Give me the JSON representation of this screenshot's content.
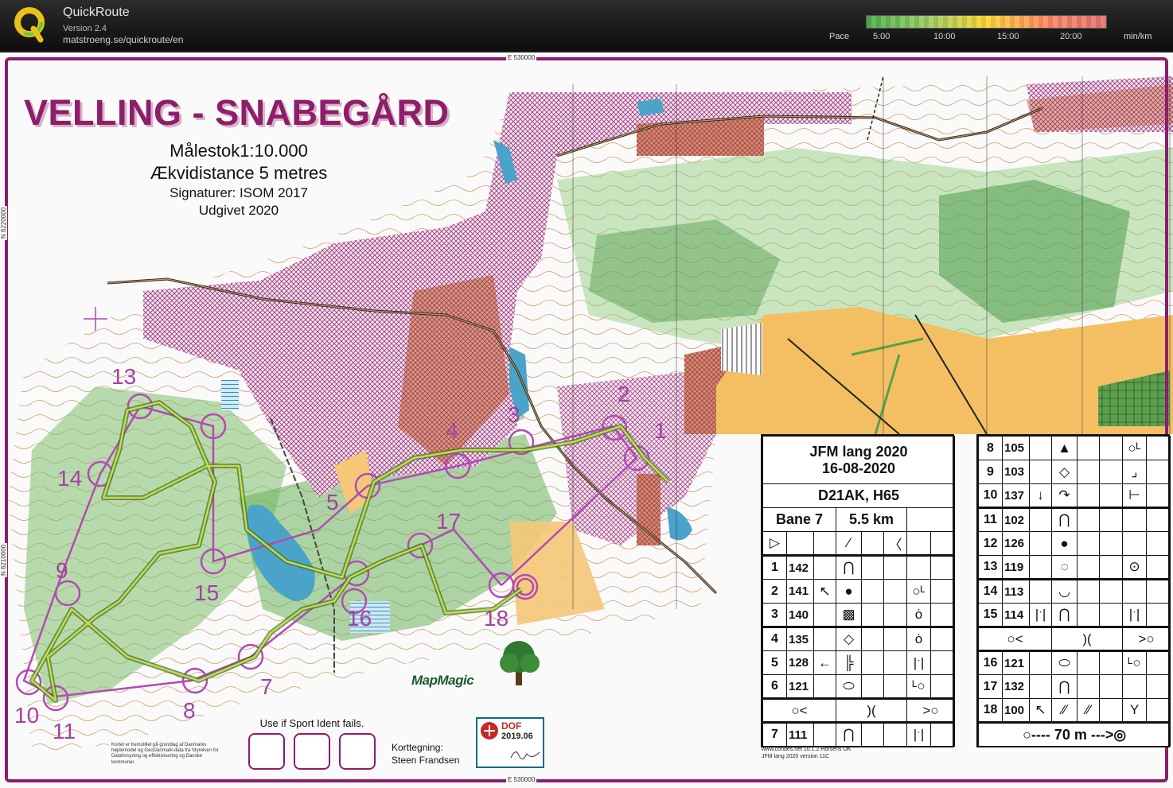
{
  "app": {
    "title": "QuickRoute",
    "version": "Version 2.4",
    "url": "matstroeng.se/quickroute/en"
  },
  "pace_scale": {
    "label": "Pace",
    "ticks": [
      "5:00",
      "10:00",
      "15:00",
      "20:00"
    ],
    "unit": "min/km",
    "colors": [
      "#4caf50",
      "#9ccc65",
      "#fdd835",
      "#ff8a65",
      "#e57373"
    ]
  },
  "map": {
    "title": "VELLING - SNABEGÅRD",
    "scale": "Målestok1:10.000",
    "contour": "Ækvidistance  5 metres",
    "symbols": "Signaturer:  ISOM 2017",
    "published": "Udgivet 2020",
    "coord_top": "E 530000",
    "coord_bottom": "E 530000",
    "coord_left_1": "N 6220000",
    "coord_left_2": "N 6210000",
    "sportident_text": "Use if Sport Ident fails.",
    "credit": "Kortet er fremstillet på grundlag af Danmarks højdemodel og GeoDanmark-data fra Styrelsen for Dataforsyning og effektivisering og Danske kommuner.",
    "mapper_label": "Korttegning:",
    "mapper_name": "Steen Frandsen",
    "dof_line1": "DOF",
    "dof_line2": "2019.06",
    "mapmagic": "MapMagic",
    "colors": {
      "purple": "#8b1d6b",
      "control": "#a342a3",
      "forest": "#4f9a4a",
      "water": "#4aa3c8",
      "open": "#f3bf62"
    },
    "control_numbers": [
      "1",
      "2",
      "3",
      "4",
      "5",
      "7",
      "8",
      "9",
      "10",
      "11",
      "13",
      "14",
      "15",
      "16",
      "17",
      "18"
    ]
  },
  "description": {
    "event": "JFM lang 2020",
    "date": "16-08-2020",
    "class": "D21AK, H65",
    "course": "Bane 7",
    "length": "5.5 km",
    "left_rows": [
      {
        "n": "1",
        "code": "142",
        "c": "",
        "d": "⋂",
        "e": "",
        "f": ""
      },
      {
        "n": "2",
        "code": "141",
        "c": "↖",
        "d": "●",
        "e": "",
        "f": "○ᴸ"
      },
      {
        "n": "3",
        "code": "140",
        "c": "",
        "d": "▩",
        "e": "",
        "f": "ȯ"
      },
      {
        "n": "4",
        "code": "135",
        "c": "",
        "d": "◇",
        "e": "",
        "f": "ȯ"
      },
      {
        "n": "5",
        "code": "128",
        "c": "←",
        "d": "╠",
        "e": "",
        "f": "|ˑ|"
      },
      {
        "n": "6",
        "code": "121",
        "c": "",
        "d": "⬭",
        "e": "",
        "f": "ᴸ○"
      }
    ],
    "left_marked": {
      "a": "○<",
      "b": ")(",
      "c": ">○"
    },
    "left_last": {
      "n": "7",
      "code": "111",
      "c": "",
      "d": "⋂",
      "e": "",
      "f": "|ˑ|"
    },
    "right_rows": [
      {
        "n": "8",
        "code": "105",
        "c": "",
        "d": "▲",
        "e": "",
        "f": "○ᴸ"
      },
      {
        "n": "9",
        "code": "103",
        "c": "",
        "d": "◇",
        "e": "",
        "f": "⌟"
      },
      {
        "n": "10",
        "code": "137",
        "c": "↓",
        "d": "↷",
        "e": "",
        "f": "⊢"
      },
      {
        "n": "11",
        "code": "102",
        "c": "",
        "d": "⋂",
        "e": "",
        "f": ""
      },
      {
        "n": "12",
        "code": "126",
        "c": "",
        "d": "●",
        "e": "",
        "f": ""
      },
      {
        "n": "13",
        "code": "119",
        "c": "",
        "d": "◌",
        "e": "",
        "f": "⊙"
      },
      {
        "n": "14",
        "code": "113",
        "c": "",
        "d": "◡",
        "e": "",
        "f": ""
      },
      {
        "n": "15",
        "code": "114",
        "c": "|ˑ|",
        "d": "⋂",
        "e": "",
        "f": "|ˑ|"
      }
    ],
    "right_marked": {
      "a": "○<",
      "b": ")(",
      "c": ">○"
    },
    "right_rows2": [
      {
        "n": "16",
        "code": "121",
        "c": "",
        "d": "⬭",
        "e": "",
        "f": "ᴸ○"
      },
      {
        "n": "17",
        "code": "132",
        "c": "",
        "d": "⋂",
        "e": "",
        "f": ""
      },
      {
        "n": "18",
        "code": "100",
        "c": "↖",
        "d": "⁄⁄",
        "e": "⁄⁄",
        "f": "Y"
      }
    ],
    "finish": "○----  70 m  --->◎",
    "footer_1": "www.condes.net 10.1.2 Horsens OK",
    "footer_2": "JFM lang 2020 version 11C"
  }
}
